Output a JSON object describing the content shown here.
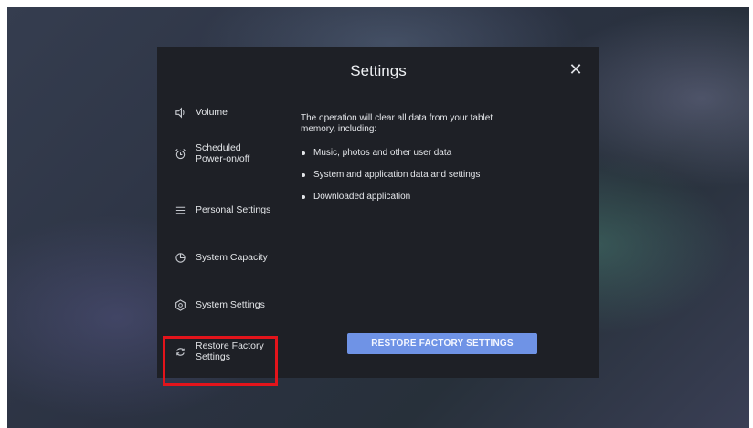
{
  "dialog": {
    "title": "Settings",
    "close_glyph": "✕"
  },
  "sidebar": {
    "items": [
      {
        "label": "Volume",
        "icon": "volume-icon"
      },
      {
        "label": "Scheduled\nPower-on/off",
        "icon": "alarm-clock-icon"
      },
      {
        "label": "Personal Settings",
        "icon": "sliders-icon"
      },
      {
        "label": "System Capacity",
        "icon": "pie-chart-icon"
      },
      {
        "label": "System Settings",
        "icon": "gear-icon"
      },
      {
        "label": "Restore Factory\nSettings",
        "icon": "restore-icon",
        "selected": true
      }
    ]
  },
  "content": {
    "description": "The operation will clear all data from your tablet memory, including:",
    "bullets": [
      "Music, photos and other user data",
      "System and application data and settings",
      "Downloaded application"
    ],
    "button_label": "RESTORE FACTORY SETTINGS"
  },
  "colors": {
    "dialog_bg": "#1e2026",
    "accent_button": "#6f93e6",
    "highlight_border": "#e3141b"
  }
}
